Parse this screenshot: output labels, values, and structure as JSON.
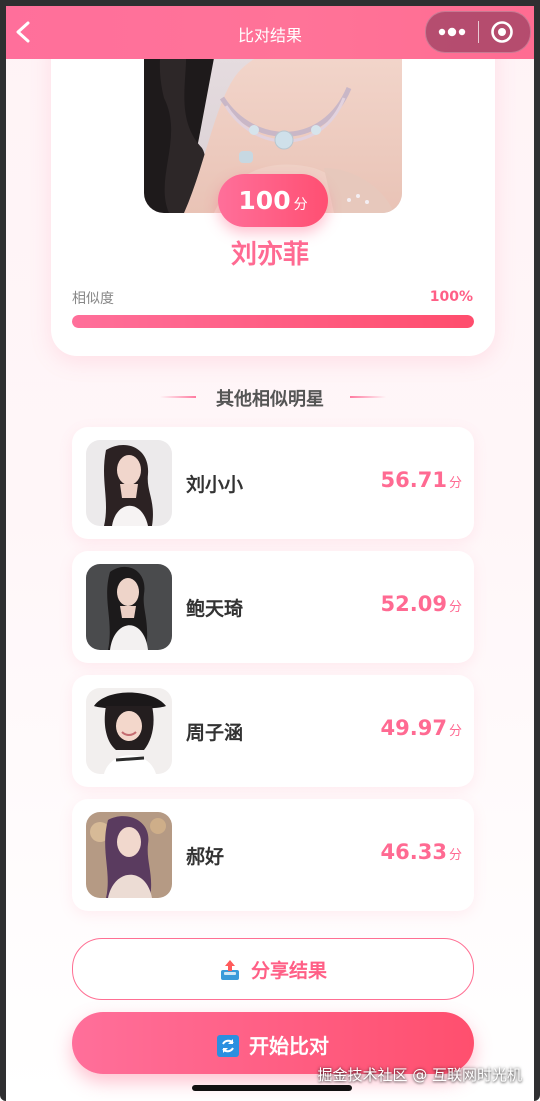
{
  "nav": {
    "title": "比对结果",
    "back_icon": "chevron-left-icon",
    "more_icon": "more-dots-icon",
    "close_icon": "target-close-icon"
  },
  "top_match": {
    "score": "100",
    "score_unit": "分",
    "name": "刘亦菲",
    "similarity_label": "相似度",
    "similarity_value": "100%",
    "similarity_fraction": 1.0
  },
  "others": {
    "title": "其他相似明星",
    "items": [
      {
        "name": "刘小小",
        "score": "56.71",
        "unit": "分"
      },
      {
        "name": "鲍天琦",
        "score": "52.09",
        "unit": "分"
      },
      {
        "name": "周子涵",
        "score": "49.97",
        "unit": "分"
      },
      {
        "name": "郝好",
        "score": "46.33",
        "unit": "分"
      }
    ]
  },
  "actions": {
    "share_label": "分享结果",
    "share_icon": "share-upload-icon",
    "start_label": "开始比对",
    "start_icon": "refresh-icon"
  },
  "watermark": "掘金技术社区 @ 互联网时光机",
  "colors": {
    "accent": "#ff6a92",
    "accent_dark": "#ff4f6e",
    "nav": "#ff7398"
  }
}
